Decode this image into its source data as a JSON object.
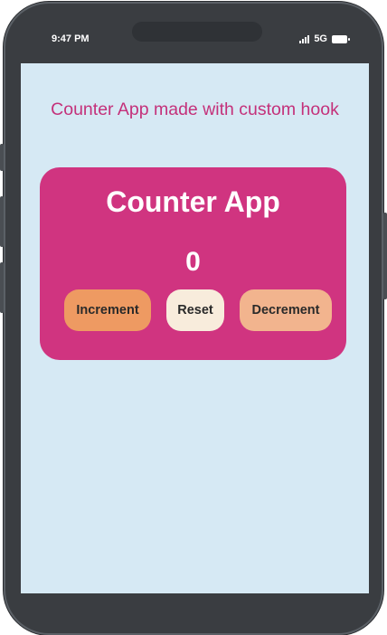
{
  "status_bar": {
    "time": "9:47 PM",
    "network": "5G",
    "icons": [
      "signal-bars-icon",
      "battery-icon"
    ]
  },
  "page": {
    "heading": "Counter App made with custom hook"
  },
  "counter": {
    "title": "Counter App",
    "value": "0",
    "buttons": {
      "increment": "Increment",
      "reset": "Reset",
      "decrement": "Decrement"
    }
  },
  "colors": {
    "screen_background": "#d6e9f4",
    "card_background": "#d03480",
    "heading_text": "#c4317a",
    "increment_button": "#ee9a62",
    "reset_button": "#f8ecdc",
    "decrement_button": "#f2b48e",
    "phone_frame": "#3a3d41"
  }
}
